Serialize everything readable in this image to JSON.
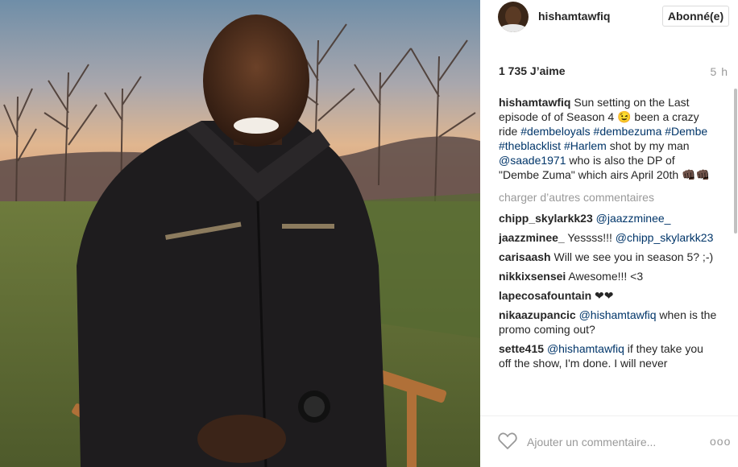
{
  "post": {
    "photo_alt": "",
    "author": "hishamtawfiq",
    "follow_label": "Abonné(e)",
    "likes": "1 735 J’aime",
    "time": "5 h",
    "caption": {
      "user": "hishamtawfiq",
      "text_1": "Sun setting on the Last episode of of Season 4 😉 been a crazy ride",
      "tag_1": "#dembeloyals",
      "tag_2": "#dembezuma",
      "tag_3": "#Dembe",
      "tag_4": "#theblacklist",
      "tag_5": "#Harlem",
      "text_2": "shot by my man",
      "mention": "@saade1971",
      "text_3": "who is also the DP of \"Dembe Zuma\" which airs April 20th",
      "emoji_tail": "👊🏿👊🏿"
    },
    "load_more": "charger d’autres commentaires",
    "comments": [
      {
        "user": "chipp_skylarkk23",
        "mention": "@jaazzminee_",
        "text": ""
      },
      {
        "user": "jaazzminee_",
        "mention": "",
        "text": "Yessss!!!",
        "mention_after": "@chipp_skylarkk23"
      },
      {
        "user": "carisaash",
        "mention": "",
        "text": "Will we see you in season 5? ;-)"
      },
      {
        "user": "nikkixsensei",
        "mention": "",
        "text": "Awesome!!! <3"
      },
      {
        "user": "lapecosafountain",
        "mention": "",
        "text": "❤❤"
      },
      {
        "user": "nikaazupancic",
        "mention": "@hishamtawfiq",
        "text": "when is the promo coming out?"
      },
      {
        "user": "sette415",
        "mention": "@hishamtawfiq",
        "text": "if they take you off the show, I'm done. I will never"
      }
    ],
    "add_comment_placeholder": "Ajouter un commentaire...",
    "more_label": "ooo"
  },
  "icons": {
    "like": "heart-outline-icon",
    "options": "more-options-icon"
  }
}
